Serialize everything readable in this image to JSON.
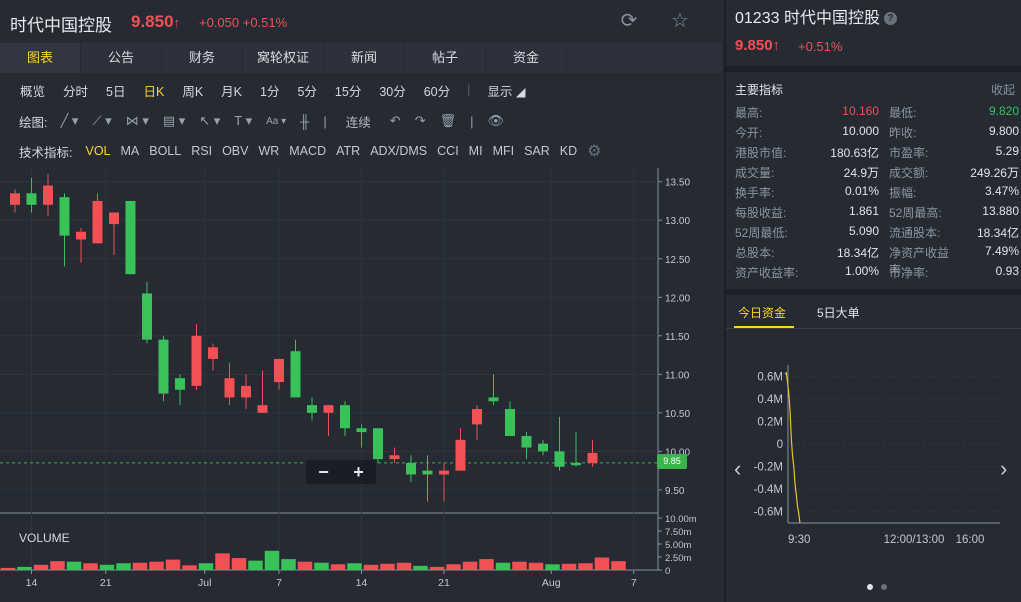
{
  "header": {
    "name": "时代中国控股",
    "price": "9.850",
    "arrow": "↑",
    "change": "+0.050 +0.51%"
  },
  "tabs": [
    "图表",
    "公告",
    "财务",
    "窝轮权证",
    "新闻",
    "帖子",
    "资金"
  ],
  "periods": [
    "概览",
    "分时",
    "5日",
    "日K",
    "周K",
    "月K",
    "1分",
    "5分",
    "15分",
    "30分",
    "60分"
  ],
  "periods_active": "日K",
  "display_label": "显示",
  "draw_label": "绘图:",
  "draw_continuous": "连续",
  "indicators_label": "技术指标:",
  "indicators": [
    "VOL",
    "MA",
    "BOLL",
    "RSI",
    "OBV",
    "WR",
    "MACD",
    "ATR",
    "ADX/DMS",
    "CCI",
    "MI",
    "MFI",
    "SAR",
    "KD"
  ],
  "price_tag": "9.85",
  "volume_label": "VOLUME",
  "chart_data": [
    {
      "type": "candlestick",
      "ylim": [
        9.2,
        13.6
      ],
      "yticks": [
        "13.50",
        "13.00",
        "12.50",
        "12.00",
        "11.50",
        "11.00",
        "10.50",
        "10.00",
        "9.50"
      ],
      "ytick_values": [
        13.5,
        13.0,
        12.5,
        12.0,
        11.5,
        11.0,
        10.5,
        10.0,
        9.5
      ],
      "xticks": [
        "14",
        "21",
        "Jul",
        "7",
        "14",
        "21",
        "Aug",
        "7"
      ],
      "xtick_index": [
        1,
        5.5,
        11.5,
        16,
        21,
        26,
        32.5,
        37.5
      ],
      "last_price": 9.85,
      "candles": [
        {
          "o": 13.2,
          "h": 13.4,
          "l": 13.1,
          "c": 13.35
        },
        {
          "o": 13.35,
          "h": 13.55,
          "l": 13.1,
          "c": 13.2
        },
        {
          "o": 13.2,
          "h": 13.6,
          "l": 13.05,
          "c": 13.45
        },
        {
          "o": 13.3,
          "h": 13.35,
          "l": 12.4,
          "c": 12.8
        },
        {
          "o": 12.75,
          "h": 12.9,
          "l": 12.45,
          "c": 12.85
        },
        {
          "o": 12.7,
          "h": 13.35,
          "l": 12.7,
          "c": 13.25
        },
        {
          "o": 12.95,
          "h": 13.1,
          "l": 12.55,
          "c": 13.1
        },
        {
          "o": 13.25,
          "h": 13.25,
          "l": 12.3,
          "c": 12.3
        },
        {
          "o": 12.05,
          "h": 12.2,
          "l": 11.4,
          "c": 11.45
        },
        {
          "o": 11.45,
          "h": 11.5,
          "l": 10.65,
          "c": 10.75
        },
        {
          "o": 10.95,
          "h": 11.0,
          "l": 10.6,
          "c": 10.8
        },
        {
          "o": 10.85,
          "h": 11.65,
          "l": 10.8,
          "c": 11.5
        },
        {
          "o": 11.2,
          "h": 11.4,
          "l": 11.05,
          "c": 11.35
        },
        {
          "o": 10.7,
          "h": 11.15,
          "l": 10.6,
          "c": 10.95
        },
        {
          "o": 10.7,
          "h": 11.0,
          "l": 10.55,
          "c": 10.85
        },
        {
          "o": 10.5,
          "h": 11.05,
          "l": 10.5,
          "c": 10.6
        },
        {
          "o": 10.9,
          "h": 11.2,
          "l": 10.8,
          "c": 11.2
        },
        {
          "o": 11.3,
          "h": 11.45,
          "l": 10.7,
          "c": 10.7
        },
        {
          "o": 10.6,
          "h": 10.7,
          "l": 10.4,
          "c": 10.5
        },
        {
          "o": 10.5,
          "h": 10.6,
          "l": 10.2,
          "c": 10.6
        },
        {
          "o": 10.6,
          "h": 10.65,
          "l": 10.2,
          "c": 10.3
        },
        {
          "o": 10.3,
          "h": 10.35,
          "l": 10.05,
          "c": 10.25
        },
        {
          "o": 10.3,
          "h": 10.3,
          "l": 9.85,
          "c": 9.9
        },
        {
          "o": 9.9,
          "h": 10.05,
          "l": 9.85,
          "c": 9.95
        },
        {
          "o": 9.85,
          "h": 9.95,
          "l": 9.6,
          "c": 9.7
        },
        {
          "o": 9.75,
          "h": 9.95,
          "l": 9.35,
          "c": 9.7
        },
        {
          "o": 9.7,
          "h": 9.85,
          "l": 9.35,
          "c": 9.75
        },
        {
          "o": 9.75,
          "h": 10.3,
          "l": 9.75,
          "c": 10.15
        },
        {
          "o": 10.35,
          "h": 10.6,
          "l": 10.15,
          "c": 10.55
        },
        {
          "o": 10.7,
          "h": 11.0,
          "l": 10.6,
          "c": 10.65
        },
        {
          "o": 10.55,
          "h": 10.65,
          "l": 10.2,
          "c": 10.2
        },
        {
          "o": 10.2,
          "h": 10.25,
          "l": 9.9,
          "c": 10.05
        },
        {
          "o": 10.1,
          "h": 10.15,
          "l": 9.95,
          "c": 10.0
        },
        {
          "o": 10.0,
          "h": 10.45,
          "l": 9.75,
          "c": 9.8
        },
        {
          "o": 9.85,
          "h": 10.25,
          "l": 9.8,
          "c": 9.82
        },
        {
          "o": 9.85,
          "h": 10.15,
          "l": 9.8,
          "c": 9.98
        }
      ]
    },
    {
      "type": "bar",
      "title": "VOLUME",
      "ylim": [
        0,
        10.0
      ],
      "yticks": [
        "10.00m",
        "7.50m",
        "5.00m",
        "2.50m",
        "0"
      ],
      "ytick_values": [
        10.0,
        7.5,
        5.0,
        2.5,
        0
      ],
      "values": [
        0.4,
        0.6,
        1.0,
        1.7,
        1.6,
        1.3,
        1.0,
        1.3,
        1.4,
        1.6,
        2.0,
        0.9,
        1.3,
        3.2,
        2.3,
        1.8,
        3.7,
        2.1,
        1.6,
        1.4,
        1.1,
        1.3,
        1.0,
        1.2,
        1.4,
        0.8,
        0.6,
        1.1,
        1.6,
        2.1,
        1.4,
        1.6,
        1.4,
        1.1,
        1.2,
        1.3,
        2.4,
        1.7
      ],
      "up": [
        true,
        false,
        true,
        true,
        false,
        true,
        false,
        false,
        true,
        true,
        true,
        true,
        false,
        true,
        true,
        false,
        false,
        false,
        true,
        false,
        true,
        false,
        true,
        true,
        true,
        false,
        true,
        true,
        true,
        true,
        false,
        true,
        true,
        false,
        true,
        true,
        true,
        true
      ]
    },
    {
      "type": "line",
      "title": "今日资金",
      "yticks": [
        "0.6M",
        "0.4M",
        "0.2M",
        "0",
        "-0.2M",
        "-0.4M",
        "-0.6M"
      ],
      "ytick_values": [
        0.6,
        0.4,
        0.2,
        0,
        -0.2,
        -0.4,
        -0.6
      ],
      "ylim": [
        -0.7,
        0.7
      ],
      "xticks": [
        "9:30",
        "12:00/13:00",
        "16:00"
      ],
      "x": [
        0,
        1,
        2,
        3,
        4,
        5,
        6,
        7,
        8,
        9,
        10,
        11,
        12
      ],
      "values": [
        0.62,
        0.63,
        0.55,
        0.45,
        0.3,
        0.05,
        -0.1,
        -0.2,
        -0.35,
        -0.45,
        -0.55,
        -0.62,
        -0.7
      ],
      "color": "#e8c52c"
    }
  ],
  "right": {
    "code_name": "01233 时代中国控股",
    "help": "?",
    "price": "9.850↑",
    "change": "+0.51%",
    "section": "主要指标",
    "collapse": "收起",
    "rows": [
      [
        "最高:",
        "10.160",
        "最低:",
        "9.820"
      ],
      [
        "今开:",
        "10.000",
        "昨收:",
        "9.800"
      ],
      [
        "港股市值:",
        "180.63亿",
        "市盈率:",
        "5.29"
      ],
      [
        "成交量:",
        "24.9万",
        "成交额:",
        "249.26万"
      ],
      [
        "换手率:",
        "0.01%",
        "振幅:",
        "3.47%"
      ],
      [
        "每股收益:",
        "1.861",
        "52周最高:",
        "13.880"
      ],
      [
        "52周最低:",
        "5.090",
        "流通股本:",
        "18.34亿"
      ],
      [
        "总股本:",
        "18.34亿",
        "净资产收益率:",
        "7.49%"
      ],
      [
        "资产收益率:",
        "1.00%",
        "市净率:",
        "0.93"
      ]
    ],
    "tab_today": "今日资金",
    "tab_5day": "5日大单"
  },
  "colors": {
    "up": "#f25055",
    "down": "#39c15a",
    "accent": "#ffd42a",
    "line": "#e8c52c"
  }
}
